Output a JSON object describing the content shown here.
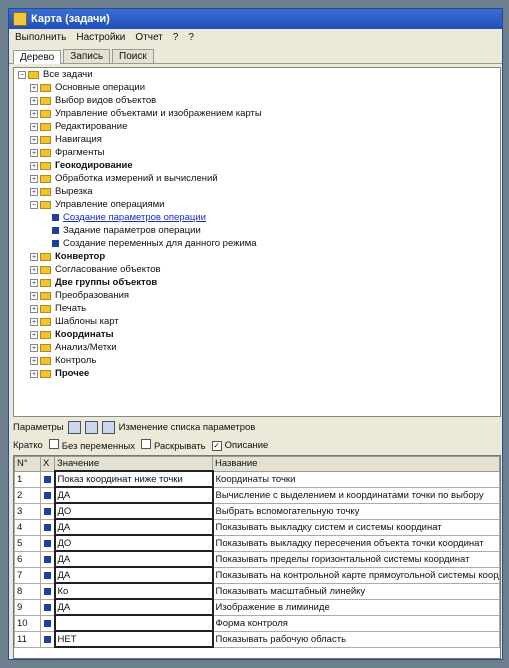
{
  "window": {
    "title": "Карта (задачи)"
  },
  "menu": [
    "Выполнить",
    "Настройки",
    "Отчет",
    "?",
    "?"
  ],
  "tabs": [
    "Дерево",
    "Запись",
    "Поиск"
  ],
  "tree": [
    {
      "label": "Все задачи",
      "level": 0,
      "icon": "folder",
      "exp": "−"
    },
    {
      "label": "Основные операции",
      "level": 1,
      "icon": "folder",
      "exp": "+"
    },
    {
      "label": "Выбор видов объектов",
      "level": 1,
      "icon": "folder",
      "exp": "+"
    },
    {
      "label": "Управление объектами и изображением карты",
      "level": 1,
      "icon": "folder",
      "exp": "+"
    },
    {
      "label": "Редактирование",
      "level": 1,
      "icon": "folder",
      "exp": "+"
    },
    {
      "label": "Навигация",
      "level": 1,
      "icon": "folder",
      "exp": "+"
    },
    {
      "label": "Фрагменты",
      "level": 1,
      "icon": "folder",
      "exp": "+"
    },
    {
      "label": "Геокодирование",
      "level": 1,
      "icon": "folder",
      "exp": "+",
      "style": "bold"
    },
    {
      "label": "Обработка измерений и вычислений",
      "level": 1,
      "icon": "folder",
      "exp": "+"
    },
    {
      "label": "Вырезка",
      "level": 1,
      "icon": "folder",
      "exp": "+"
    },
    {
      "label": "Управление операциями",
      "level": 1,
      "icon": "folder",
      "exp": "−"
    },
    {
      "label": "Создание параметров операции",
      "level": 2,
      "icon": "leaf",
      "style": "link"
    },
    {
      "label": "Задание параметров операции",
      "level": 2,
      "icon": "leaf"
    },
    {
      "label": "Создание переменных для данного режима",
      "level": 2,
      "icon": "leaf"
    },
    {
      "label": "Конвертор",
      "level": 1,
      "icon": "folder",
      "exp": "+",
      "style": "bold"
    },
    {
      "label": "Согласование объектов",
      "level": 1,
      "icon": "folder",
      "exp": "+"
    },
    {
      "label": "Две группы объектов",
      "level": 1,
      "icon": "folder",
      "exp": "+",
      "style": "bold"
    },
    {
      "label": "Преобразования",
      "level": 1,
      "icon": "folder",
      "exp": "+"
    },
    {
      "label": "Печать",
      "level": 1,
      "icon": "folder",
      "exp": "+"
    },
    {
      "label": "Шаблоны карт",
      "level": 1,
      "icon": "folder",
      "exp": "+"
    },
    {
      "label": "Координаты",
      "level": 1,
      "icon": "folder",
      "exp": "+",
      "style": "bold"
    },
    {
      "label": "Анализ/Метки",
      "level": 1,
      "icon": "folder",
      "exp": "+"
    },
    {
      "label": "Контроль",
      "level": 1,
      "icon": "folder",
      "exp": "+"
    },
    {
      "label": "Прочее",
      "level": 1,
      "icon": "folder",
      "exp": "+",
      "style": "bold"
    }
  ],
  "params_toolbar": {
    "label": "Параметры",
    "caption": "Изменение списка параметров"
  },
  "filter_bar": {
    "label": "Кратко",
    "opt1": "Без переменных",
    "opt2": "Раскрывать",
    "opt3": "Описание",
    "opt3_checked": true
  },
  "grid": {
    "headers": [
      "N°",
      "Х",
      "Значение",
      "Название"
    ],
    "rows": [
      {
        "n": "1",
        "value": "Показ координат ниже точки",
        "name": "Координаты точки"
      },
      {
        "n": "2",
        "value": "ДА",
        "name": "Вычисление с выделением и координатами точки по выбору"
      },
      {
        "n": "3",
        "value": "ДО",
        "name": "Выбрать вспомогательную точку"
      },
      {
        "n": "4",
        "value": "ДА",
        "name": "Показывать выкладку систем и системы координат"
      },
      {
        "n": "5",
        "value": "ДО",
        "name": "Показывать выкладку пересечения объекта точки координат"
      },
      {
        "n": "6",
        "value": "ДА",
        "name": "Показывать пределы горизонтальной системы координат"
      },
      {
        "n": "7",
        "value": "ДА",
        "name": "Показывать на контрольной карте прямоугольной системы координат"
      },
      {
        "n": "8",
        "value": "Ко",
        "name": "Показывать масштабный линейку"
      },
      {
        "n": "9",
        "value": "ДА",
        "name": "Изображение в лиминиде"
      },
      {
        "n": "10",
        "value": "",
        "name": "Форма контроля"
      },
      {
        "n": "11",
        "value": "НЕТ",
        "name": "Показывать рабочую область"
      }
    ]
  }
}
